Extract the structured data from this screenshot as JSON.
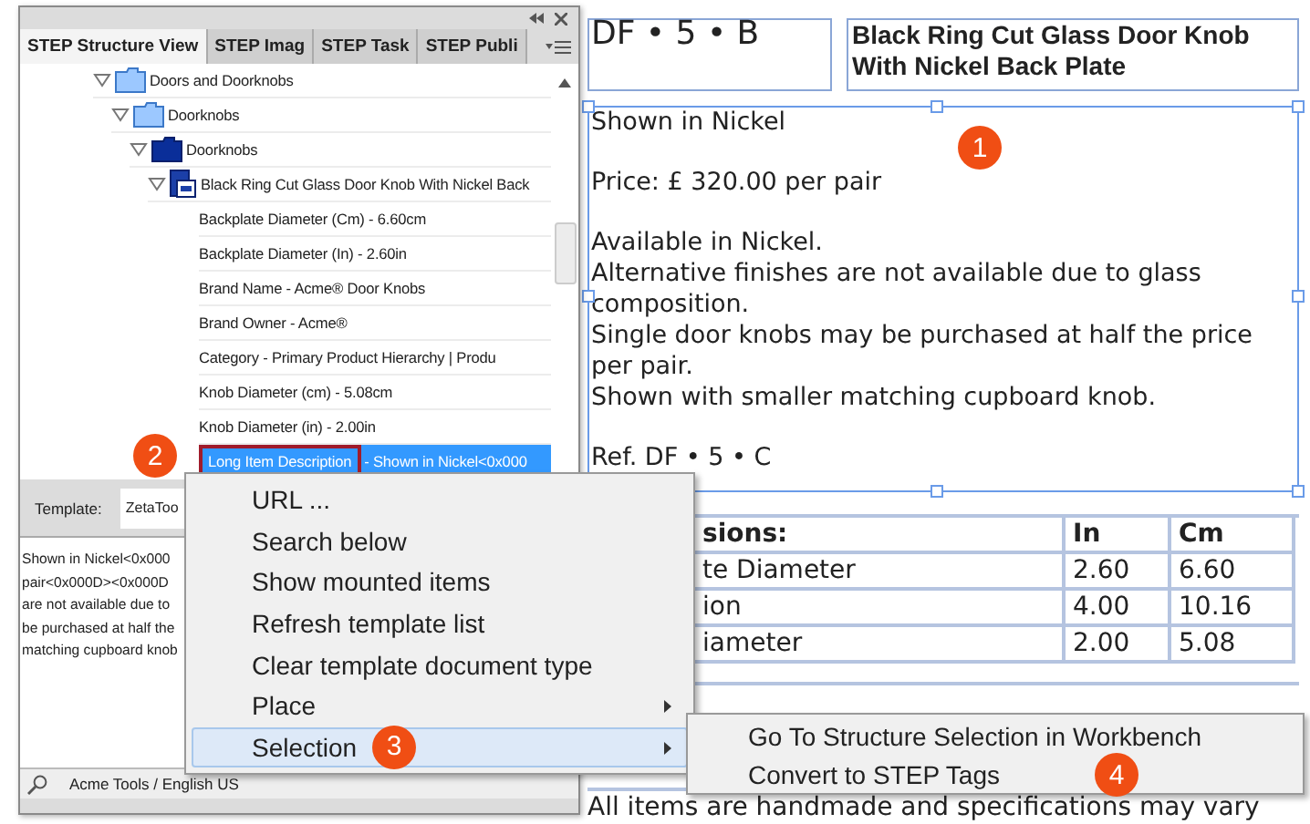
{
  "panel": {
    "tabs": [
      {
        "label": "STEP Structure View",
        "selected": true
      },
      {
        "label": "STEP Imag",
        "selected": false
      },
      {
        "label": "STEP Task",
        "selected": false
      },
      {
        "label": "STEP Publi",
        "selected": false
      }
    ],
    "tree": [
      {
        "label": "Doors and Doorknobs",
        "kind": "folder",
        "expanded": true,
        "selected": false,
        "children": [
          {
            "label": "Doorknobs",
            "kind": "folder",
            "expanded": true,
            "selected": false,
            "children": [
              {
                "label": "Doorknobs",
                "kind": "dark-folder",
                "expanded": true,
                "selected": false,
                "children": [
                  {
                    "label": "Black Ring Cut Glass Door Knob With Nickel Back",
                    "kind": "product",
                    "expanded": true,
                    "selected": false,
                    "children": [
                      {
                        "label": "Backplate Diameter (Cm) - 6.60cm",
                        "selected": false
                      },
                      {
                        "label": "Backplate Diameter (In) - 2.60in",
                        "selected": false
                      },
                      {
                        "label": "Brand Name - Acme® Door Knobs",
                        "selected": false
                      },
                      {
                        "label": "Brand Owner - Acme®",
                        "selected": false
                      },
                      {
                        "label": "Category - Primary Product Hierarchy | Produ",
                        "selected": false
                      },
                      {
                        "label": "Knob Diameter (cm) - 5.08cm",
                        "selected": false
                      },
                      {
                        "label": "Knob Diameter (in) - 2.00in",
                        "selected": false
                      },
                      {
                        "label": "Long Item Description",
                        "suffix": "- Shown in Nickel<0x000",
                        "selected": true,
                        "annotated": true,
                        "callout": "2"
                      }
                    ]
                  }
                ]
              }
            ]
          }
        ]
      }
    ],
    "template_label": "Template:",
    "template_value": "ZetaToo",
    "preview_lines": [
      "Shown in Nickel<0x000",
      "pair<0x000D><0x000D",
      "are not available due to",
      "be purchased at half the",
      "matching cupboard knob"
    ],
    "status": "Acme Tools / English US"
  },
  "context_menu": [
    {
      "label": "URL ...",
      "submenu": false,
      "highlighted": false
    },
    {
      "label": "Search below",
      "submenu": false,
      "highlighted": false
    },
    {
      "label": "Show mounted items",
      "submenu": false,
      "highlighted": false
    },
    {
      "label": "Refresh template list",
      "submenu": false,
      "highlighted": false
    },
    {
      "label": "Clear template document type",
      "submenu": false,
      "highlighted": false
    },
    {
      "label": "Place",
      "submenu": true,
      "highlighted": false
    },
    {
      "label": "Selection",
      "submenu": true,
      "highlighted": true,
      "callout": "3"
    }
  ],
  "submenu": [
    {
      "label": "Go To Structure Selection in Workbench"
    },
    {
      "label": "Convert to STEP Tags",
      "callout": "4"
    }
  ],
  "document": {
    "code_frame": "DF • 5 • B",
    "title_frame": "Black Ring Cut Glass Door Knob With Nickel Back Plate",
    "text_frame": {
      "selected": true,
      "callout": "1",
      "paragraphs": [
        {
          "lines": [
            "Shown in Nickel"
          ]
        },
        {
          "lines": [
            "Price: £ 320.00 per pair"
          ]
        },
        {
          "lines": [
            "Available in Nickel.",
            "Alternative finishes are not available due to glass composition.",
            "Single door knobs may be purchased at half the price per pair.",
            "Shown with smaller matching cupboard knob."
          ]
        },
        {
          "lines": [
            "Ref. DF • 5 • C"
          ]
        }
      ]
    },
    "table": {
      "columns": [
        "sions:",
        "In",
        "Cm"
      ],
      "rows": [
        [
          "te Diameter",
          "2.60",
          "6.60"
        ],
        [
          "ion",
          "4.00",
          "10.16"
        ],
        [
          "iameter",
          "2.00",
          "5.08"
        ]
      ]
    },
    "footer": "All items are handmade and specifications may vary"
  }
}
